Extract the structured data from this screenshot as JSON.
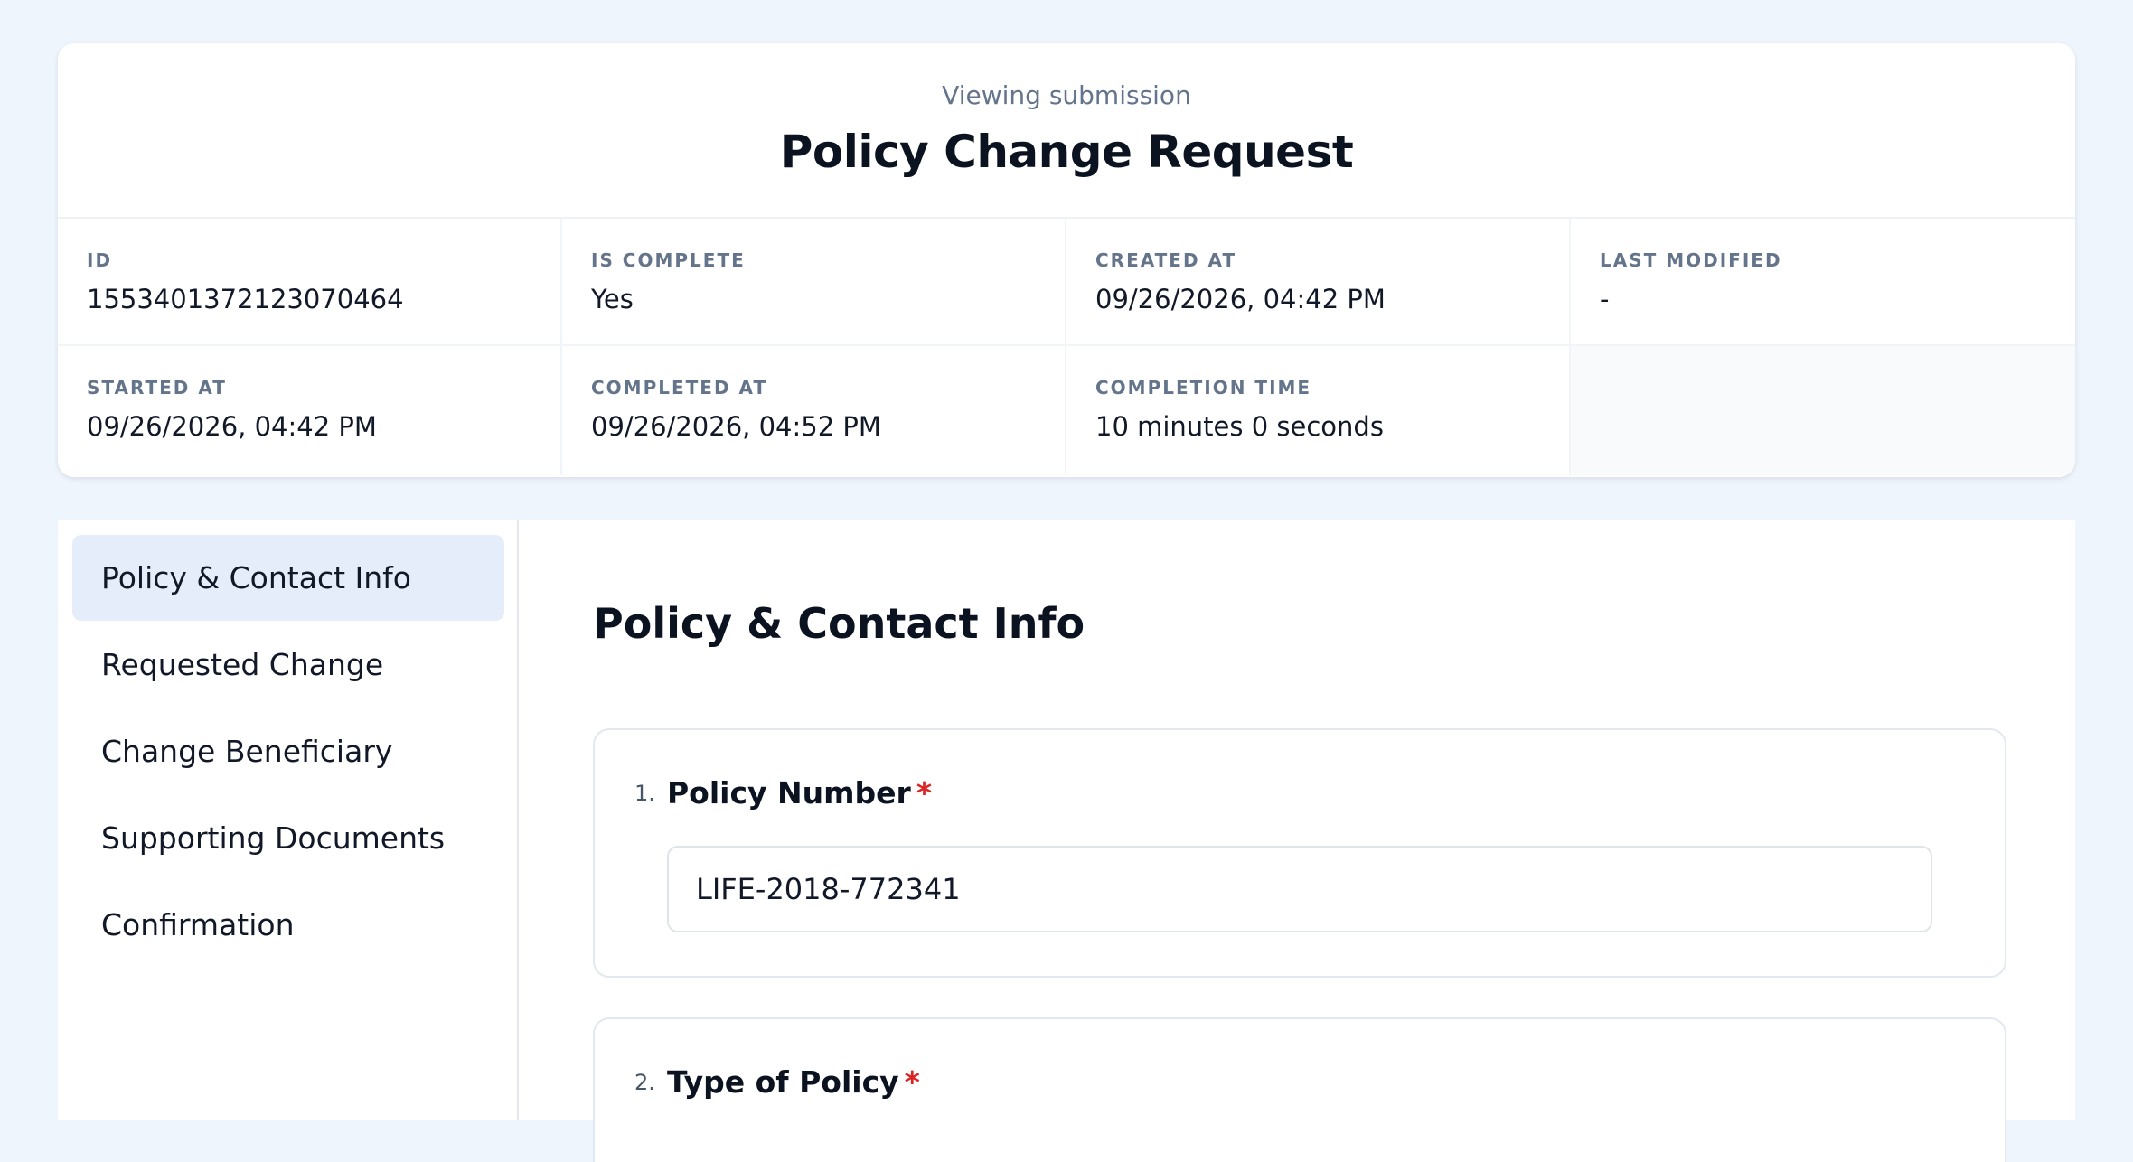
{
  "header": {
    "subtitle": "Viewing submission",
    "title": "Policy Change Request"
  },
  "meta": {
    "id_label": "ID",
    "id_value": "1553401372123070464",
    "is_complete_label": "IS COMPLETE",
    "is_complete_value": "Yes",
    "created_at_label": "CREATED AT",
    "created_at_value": "09/26/2026, 04:42 PM",
    "last_modified_label": "LAST MODIFIED",
    "last_modified_value": "-",
    "started_at_label": "STARTED AT",
    "started_at_value": "09/26/2026, 04:42 PM",
    "completed_at_label": "COMPLETED AT",
    "completed_at_value": "09/26/2026, 04:52 PM",
    "completion_time_label": "COMPLETION TIME",
    "completion_time_value": "10 minutes 0 seconds"
  },
  "sidebar": {
    "items": [
      {
        "label": "Policy & Contact Info",
        "active": true
      },
      {
        "label": "Requested Change",
        "active": false
      },
      {
        "label": "Change Beneficiary",
        "active": false
      },
      {
        "label": "Supporting Documents",
        "active": false
      },
      {
        "label": "Confirmation",
        "active": false
      }
    ]
  },
  "section": {
    "title": "Policy & Contact Info",
    "questions": [
      {
        "number": "1.",
        "title": "Policy Number",
        "required_mark": "*",
        "value": "LIFE-2018-772341"
      },
      {
        "number": "2.",
        "title": "Type of Policy",
        "required_mark": "*"
      }
    ]
  },
  "colors": {
    "page_background": "#eff5fd",
    "active_nav_background": "#e4edf9",
    "required_mark": "#dc2626",
    "label_gray": "#64748b"
  }
}
